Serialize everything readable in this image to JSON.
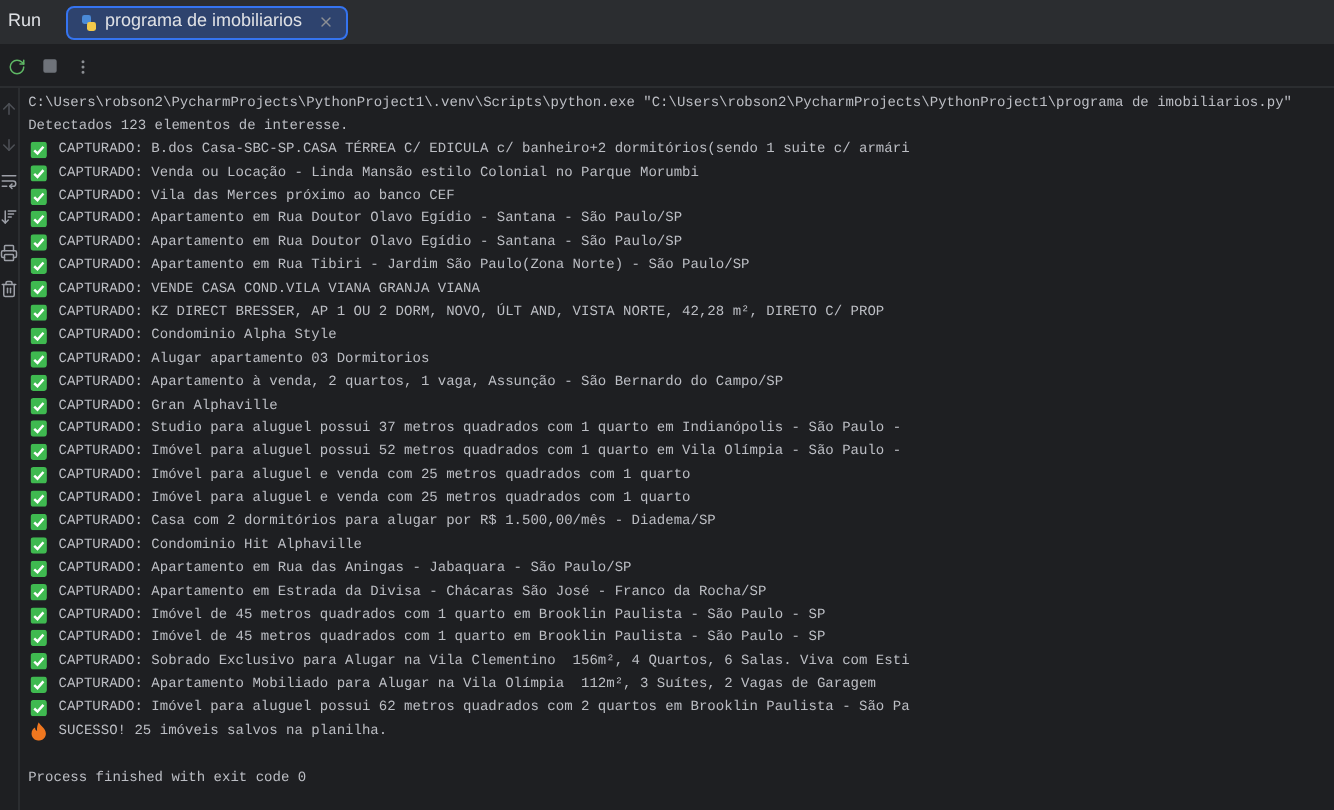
{
  "run_header": {
    "label": "Run",
    "tabs": [
      {
        "label": "programa de imobiliarios",
        "selected": true
      }
    ]
  },
  "console": {
    "lines": [
      {
        "kind": "plain",
        "text": "C:\\Users\\robson2\\PycharmProjects\\PythonProject1\\.venv\\Scripts\\python.exe \"C:\\Users\\robson2\\PycharmProjects\\PythonProject1\\programa de imobiliarios.py\""
      },
      {
        "kind": "plain",
        "text": "Detectados 123 elementos de interesse."
      },
      {
        "kind": "captured",
        "text": "CAPTURADO: B.dos Casa-SBC-SP.CASA TÉRREA C/ EDICULA c/ banheiro+2 dormitórios(sendo 1 suite c/ armári"
      },
      {
        "kind": "captured",
        "text": "CAPTURADO: Venda ou Locação - Linda Mansão estilo Colonial no Parque Morumbi"
      },
      {
        "kind": "captured",
        "text": "CAPTURADO: Vila das Merces próximo ao banco CEF"
      },
      {
        "kind": "captured",
        "text": "CAPTURADO: Apartamento em Rua Doutor Olavo Egídio - Santana - São Paulo/SP"
      },
      {
        "kind": "captured",
        "text": "CAPTURADO: Apartamento em Rua Doutor Olavo Egídio - Santana - São Paulo/SP"
      },
      {
        "kind": "captured",
        "text": "CAPTURADO: Apartamento em Rua Tibiri - Jardim São Paulo(Zona Norte) - São Paulo/SP"
      },
      {
        "kind": "captured",
        "text": "CAPTURADO: VENDE CASA COND.VILA VIANA GRANJA VIANA"
      },
      {
        "kind": "captured",
        "text": "CAPTURADO: KZ DIRECT BRESSER, AP 1 OU 2 DORM, NOVO, ÚLT AND, VISTA NORTE, 42,28 m², DIRETO C/ PROP"
      },
      {
        "kind": "captured",
        "text": "CAPTURADO: Condominio Alpha Style"
      },
      {
        "kind": "captured",
        "text": "CAPTURADO: Alugar apartamento 03 Dormitorios"
      },
      {
        "kind": "captured",
        "text": "CAPTURADO: Apartamento à venda, 2 quartos, 1 vaga, Assunção - São Bernardo do Campo/SP"
      },
      {
        "kind": "captured",
        "text": "CAPTURADO: Gran Alphaville"
      },
      {
        "kind": "captured",
        "text": "CAPTURADO: Studio para aluguel possui 37 metros quadrados com 1 quarto em Indianópolis - São Paulo -"
      },
      {
        "kind": "captured",
        "text": "CAPTURADO: Imóvel para aluguel possui 52 metros quadrados com 1 quarto em Vila Olímpia - São Paulo -"
      },
      {
        "kind": "captured",
        "text": "CAPTURADO: Imóvel para aluguel e venda com 25 metros quadrados com 1 quarto"
      },
      {
        "kind": "captured",
        "text": "CAPTURADO: Imóvel para aluguel e venda com 25 metros quadrados com 1 quarto"
      },
      {
        "kind": "captured",
        "text": "CAPTURADO: Casa com 2 dormitórios para alugar por R$ 1.500,00/mês - Diadema/SP"
      },
      {
        "kind": "captured",
        "text": "CAPTURADO: Condominio Hit Alphaville"
      },
      {
        "kind": "captured",
        "text": "CAPTURADO: Apartamento em Rua das Aningas - Jabaquara - São Paulo/SP"
      },
      {
        "kind": "captured",
        "text": "CAPTURADO: Apartamento em Estrada da Divisa - Chácaras São José - Franco da Rocha/SP"
      },
      {
        "kind": "captured",
        "text": "CAPTURADO: Imóvel de 45 metros quadrados com 1 quarto em Brooklin Paulista - São Paulo - SP"
      },
      {
        "kind": "captured",
        "text": "CAPTURADO: Imóvel de 45 metros quadrados com 1 quarto em Brooklin Paulista - São Paulo - SP"
      },
      {
        "kind": "captured",
        "text": "CAPTURADO: Sobrado Exclusivo para Alugar na Vila Clementino  156m², 4 Quartos, 6 Salas. Viva com Esti"
      },
      {
        "kind": "captured",
        "text": "CAPTURADO: Apartamento Mobiliado para Alugar na Vila Olímpia  112m², 3 Suítes, 2 Vagas de Garagem"
      },
      {
        "kind": "captured",
        "text": "CAPTURADO: Imóvel para aluguel possui 62 metros quadrados com 2 quartos em Brooklin Paulista - São Pa"
      },
      {
        "kind": "success",
        "text": "SUCESSO! 25 imóveis salvos na planilha."
      },
      {
        "kind": "blank"
      },
      {
        "kind": "plain",
        "text": "Process finished with exit code 0"
      }
    ]
  }
}
